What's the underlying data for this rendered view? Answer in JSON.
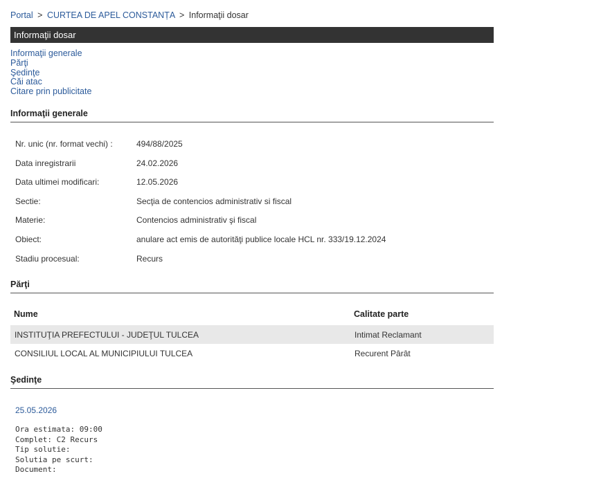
{
  "breadcrumb": {
    "items": [
      "Portal",
      "CURTEA DE APEL CONSTANȚA",
      "Informaţii dosar"
    ],
    "separator": ">"
  },
  "title": "Informaţii dosar",
  "toc": [
    "Informaţii generale",
    "Părţi",
    "Şedinţe",
    "Căi atac",
    "Citare prin publicitate"
  ],
  "info": {
    "heading": "Informaţii generale",
    "rows": [
      {
        "label": "Nr. unic (nr. format vechi) :",
        "value": "494/88/2025"
      },
      {
        "label": "Data inregistrarii",
        "value": "24.02.2026"
      },
      {
        "label": "Data ultimei modificari:",
        "value": "12.05.2026"
      },
      {
        "label": "Sectie:",
        "value": "Secţia de contencios administrativ si fiscal"
      },
      {
        "label": "Materie:",
        "value": "Contencios administrativ şi fiscal"
      },
      {
        "label": "Obiect:",
        "value": "anulare act emis de autorităţi publice locale HCL nr. 333/19.12.2024"
      },
      {
        "label": "Stadiu procesual:",
        "value": "Recurs"
      }
    ]
  },
  "parti": {
    "heading": "Părţi",
    "col_nume": "Nume",
    "col_calitate": "Calitate parte",
    "rows": [
      {
        "nume": "INSTITUŢIA PREFECTULUI - JUDEŢUL TULCEA",
        "calitate": "Intimat Reclamant"
      },
      {
        "nume": "CONSILIUL LOCAL AL MUNICIPIULUI TULCEA",
        "calitate": "Recurent Pârât"
      }
    ]
  },
  "sedinte": {
    "heading": "Şedinţe",
    "date": "25.05.2026",
    "details": [
      "Ora estimata: 09:00",
      "Complet: C2 Recurs",
      "Tip solutie:",
      "Solutia pe scurt:",
      "Document:"
    ]
  },
  "colors": {
    "title_bar": "#333333",
    "link": "#2b5a9a",
    "row_shade": "#e8e8e8"
  }
}
